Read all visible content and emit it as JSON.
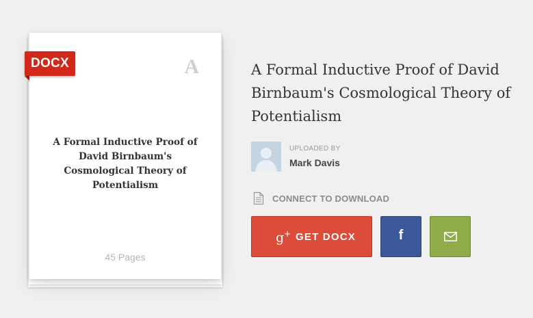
{
  "document": {
    "format_badge": "DOCX",
    "letter_watermark": "A",
    "cover_title": "A Formal Inductive Proof of David Birnbaum's Cosmological Theory of Potentialism",
    "pages": "45 Pages"
  },
  "title": "A Formal Inductive Proof of David Birnbaum's Cosmological Theory of Potentialism",
  "uploader": {
    "label": "UPLOADED BY",
    "name": "Mark Davis"
  },
  "download": {
    "connect_label": "CONNECT TO DOWNLOAD",
    "get_button_label": "GET DOCX",
    "get_button_icon": "google-plus-icon",
    "facebook_icon": "facebook-icon",
    "email_icon": "envelope-icon"
  },
  "colors": {
    "badge": "#d0291c",
    "google": "#dd4b39",
    "facebook": "#3b5998",
    "email": "#8fab4a"
  }
}
